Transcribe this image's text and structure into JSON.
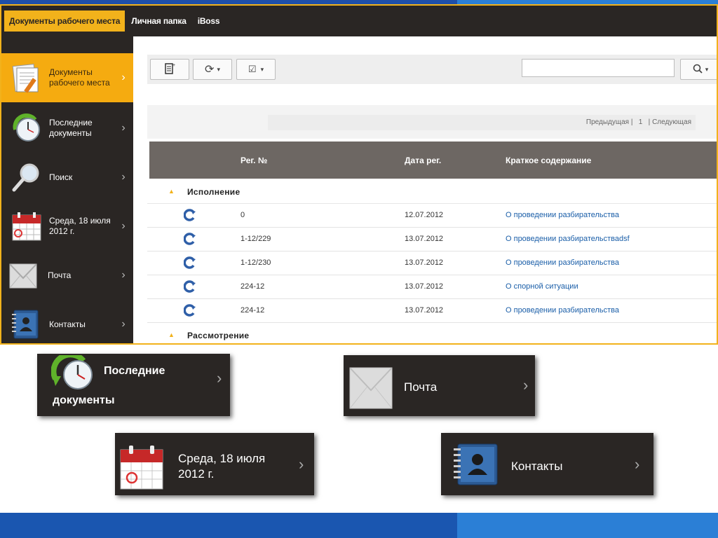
{
  "topnav": {
    "tabs": [
      "Документы рабочего места",
      "Личная папка",
      "iBoss"
    ]
  },
  "sidebar": {
    "items": [
      {
        "label": "Документы рабочего места",
        "icon": "documents-icon"
      },
      {
        "label": "Последние документы",
        "icon": "clock-icon"
      },
      {
        "label": "Поиск",
        "icon": "magnifier-icon"
      },
      {
        "label": "Среда, 18 июля 2012 г.",
        "icon": "calendar-icon"
      },
      {
        "label": "Почта",
        "icon": "envelope-icon"
      },
      {
        "label": "Контакты",
        "icon": "address-book-icon"
      }
    ]
  },
  "toolbar": {
    "search_value": ""
  },
  "pager": {
    "prev": "Предыдущая",
    "page": "1",
    "next": "Следующая"
  },
  "table": {
    "columns": [
      "Рег. №",
      "Дата рег.",
      "Краткое содержание"
    ],
    "groups": [
      {
        "label": "Исполнение",
        "rows": [
          {
            "reg": "0",
            "date": "12.07.2012",
            "summary": "О проведении разбирательства"
          },
          {
            "reg": "1-12/229",
            "date": "13.07.2012",
            "summary": "О проведении разбирательстваdsf"
          },
          {
            "reg": "1-12/230",
            "date": "13.07.2012",
            "summary": "О проведении разбирательства"
          },
          {
            "reg": "224-12",
            "date": "13.07.2012",
            "summary": "О спорной ситуации"
          },
          {
            "reg": "224-12",
            "date": "13.07.2012",
            "summary": "О проведении разбирательства"
          }
        ]
      },
      {
        "label": "Рассмотрение",
        "rows": []
      }
    ]
  },
  "callouts": {
    "recent": "Последние документы",
    "recent_line1": "Последние",
    "recent_line2": "документы",
    "mail": "Почта",
    "calendar_line1": "Среда, 18 июля",
    "calendar_line2": "2012 г.",
    "contacts": "Контакты"
  },
  "colors": {
    "accent": "#f2b21b",
    "dark": "#2a2624",
    "link": "#1a5ea8",
    "brand_blue": "#1a56b0"
  }
}
